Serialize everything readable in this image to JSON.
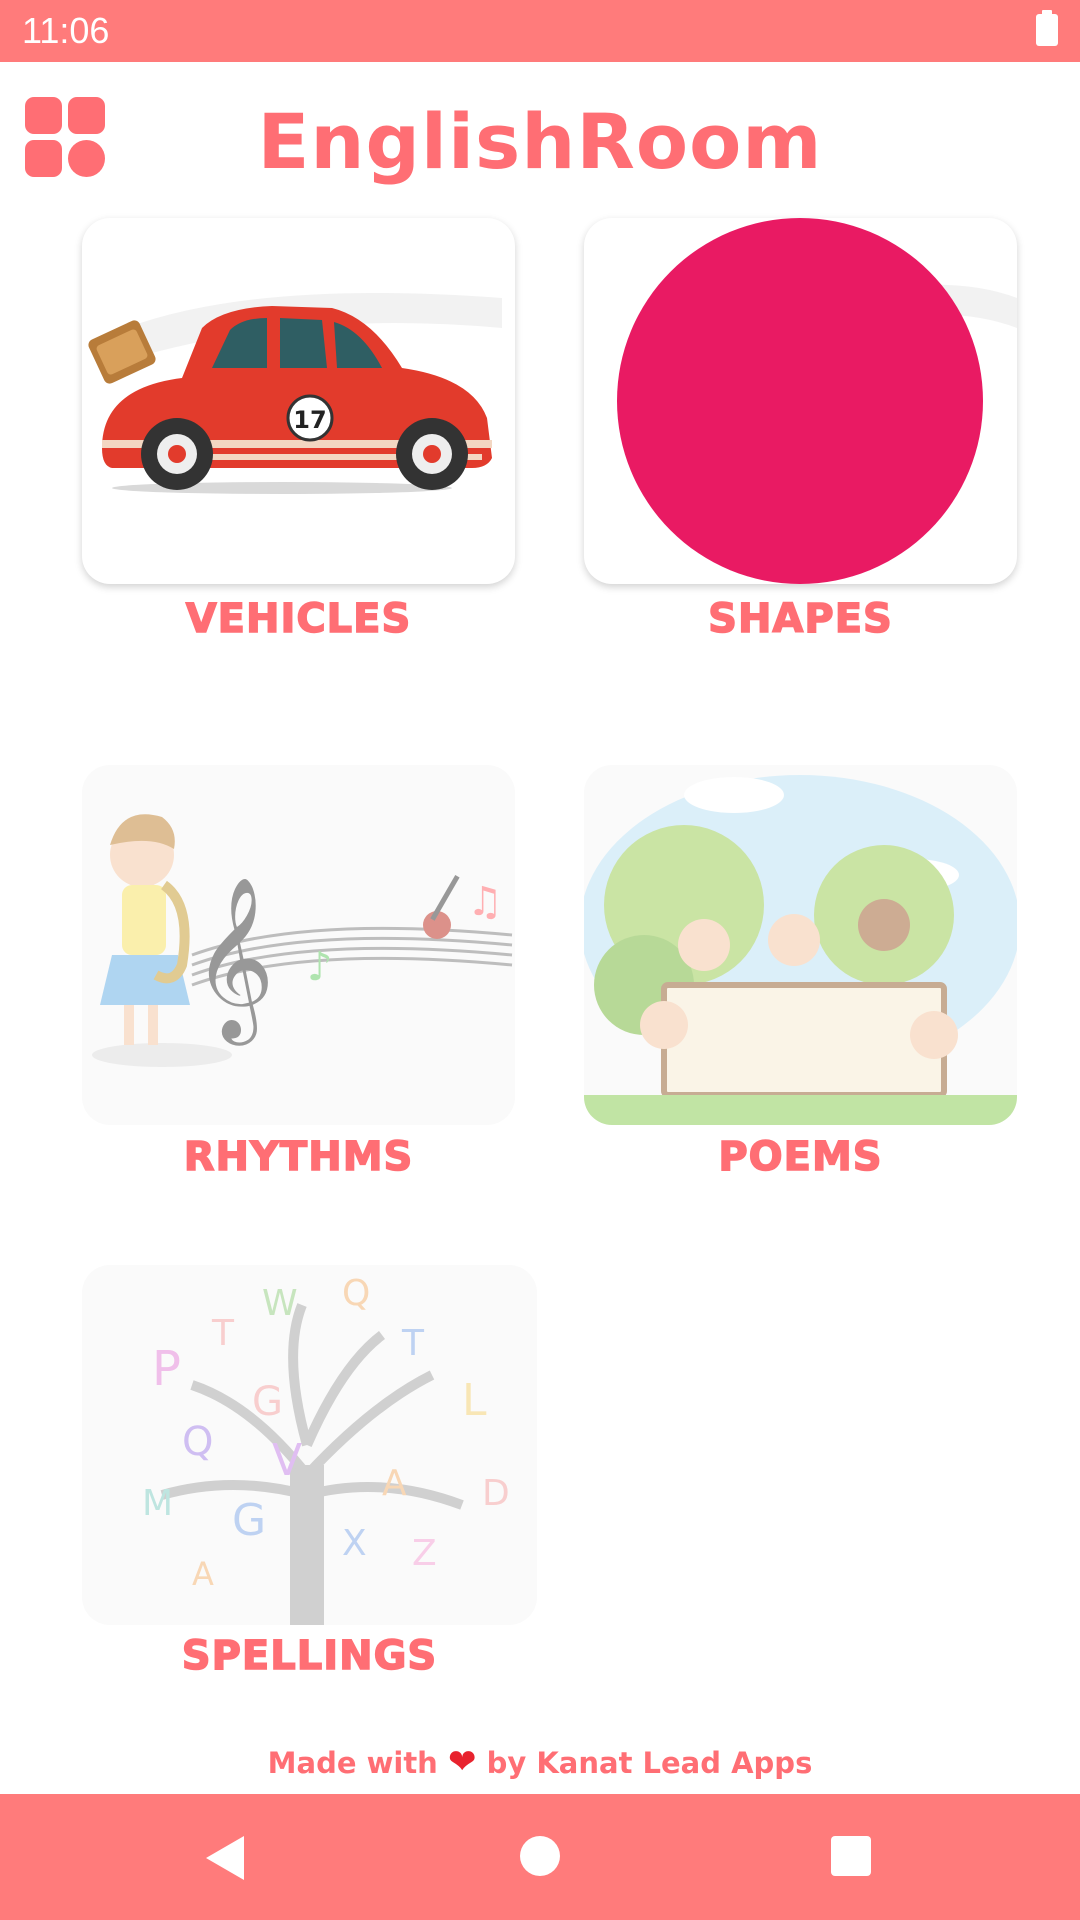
{
  "status_bar": {
    "time": "11:06",
    "battery_icon": "battery-full-icon"
  },
  "header": {
    "title": "EnglishRoom",
    "menu_icon": "grid-menu-icon"
  },
  "categories": [
    {
      "label": "VEHICLES",
      "image": "red-car-illustration",
      "enabled": true
    },
    {
      "label": "SHAPES",
      "image": "pink-circle-illustration",
      "enabled": true
    },
    {
      "label": "RHYTHMS",
      "image": "girl-playing-saxophone-illustration",
      "enabled": false
    },
    {
      "label": "POEMS",
      "image": "kids-reading-by-tree-illustration",
      "enabled": false
    },
    {
      "label": "SPELLINGS",
      "image": "alphabet-tree-illustration",
      "enabled": false
    }
  ],
  "footer": {
    "prefix": "Made with",
    "suffix": "by Kanat Lead Apps",
    "heart_icon": "heart-icon"
  },
  "nav_bar": {
    "back": "back-icon",
    "home": "home-icon",
    "recents": "recents-icon"
  },
  "colors": {
    "accent": "#ff6e74",
    "bars": "#ff7b7b",
    "circle": "#e91a63"
  }
}
